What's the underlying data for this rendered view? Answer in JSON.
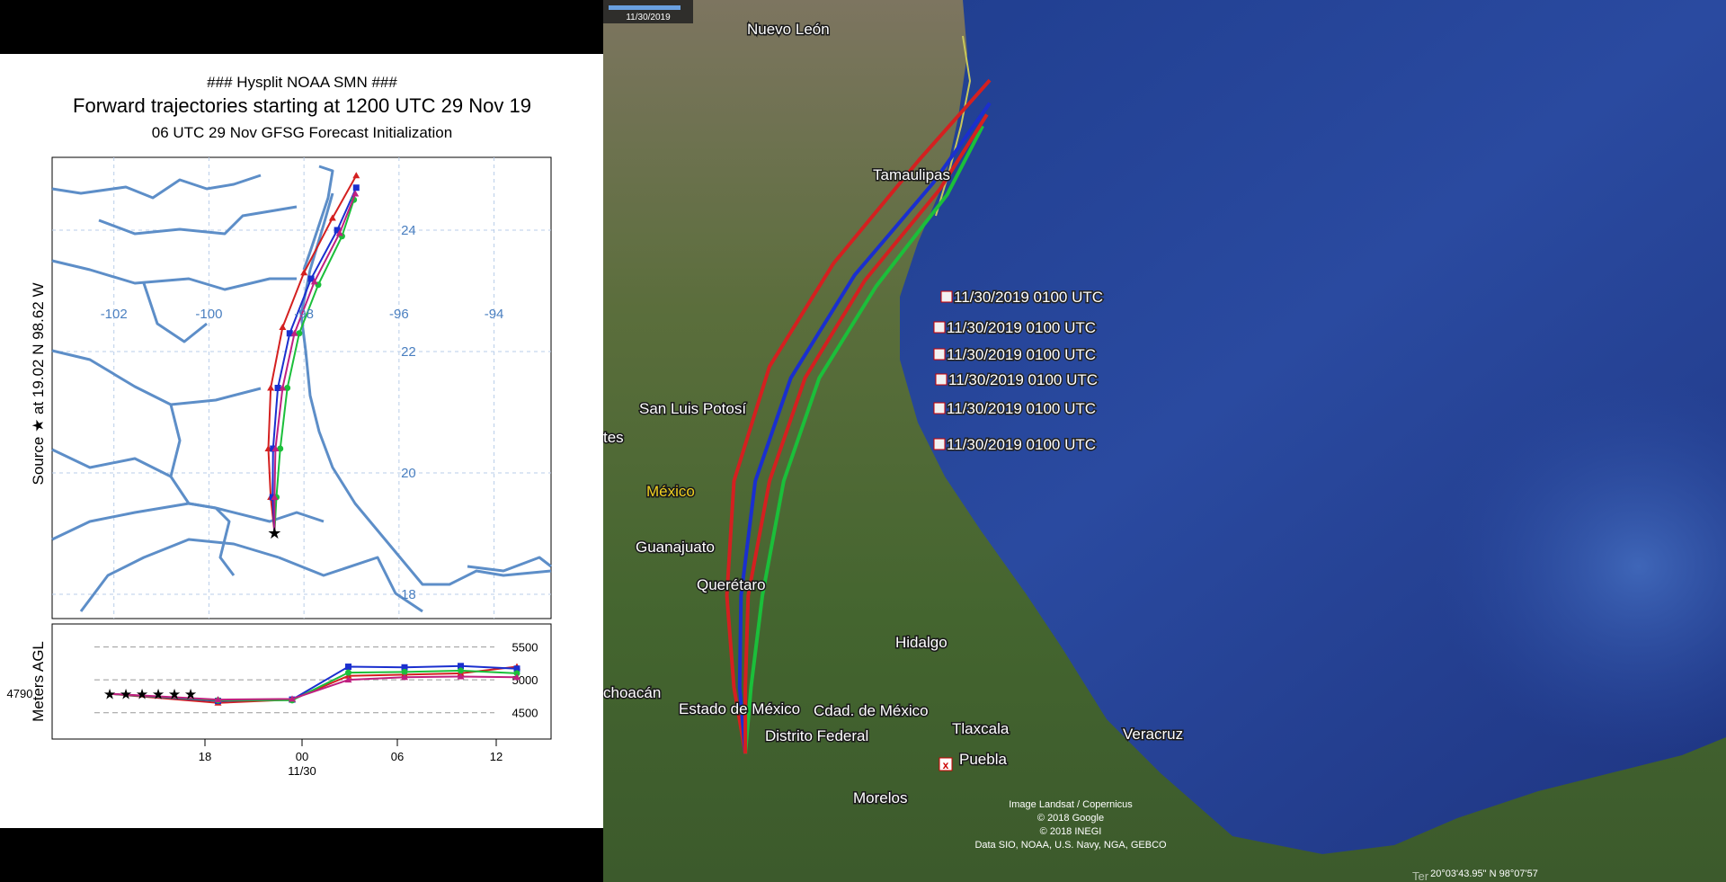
{
  "hysplit": {
    "title1": "### Hysplit NOAA  SMN ###",
    "title2": "Forward trajectories starting at 1200 UTC 29 Nov 19",
    "title3": "06 UTC 29 Nov    GFSG  Forecast Initialization",
    "source_label": "Source ★ at    19.02 N    98.62 W",
    "lon_ticks": [
      {
        "v": -102,
        "label": "-102"
      },
      {
        "v": -100,
        "label": "-100"
      },
      {
        "v": -98,
        "label": "-98"
      },
      {
        "v": -96,
        "label": "-96"
      },
      {
        "v": -94,
        "label": "-94"
      }
    ],
    "lat_ticks": [
      {
        "v": 24,
        "label": "24"
      },
      {
        "v": 22,
        "label": "22"
      },
      {
        "v": 20,
        "label": "20"
      },
      {
        "v": 18,
        "label": "18"
      }
    ],
    "height": {
      "ylabel": "Meters AGL",
      "start_label": "4790",
      "ticks": [
        "5500",
        "5000",
        "4500"
      ],
      "xticks": [
        "18",
        "00",
        "06",
        "12"
      ],
      "date_label": "11/30"
    }
  },
  "chart_data": {
    "type": "line",
    "title": "### Hysplit NOAA  SMN ###",
    "subtitle": "Forward trajectories starting at 1200 UTC 29 Nov 19",
    "source": {
      "lat": 19.02,
      "lon": -98.62
    },
    "xlim": [
      -103.3,
      -92.8
    ],
    "ylim": [
      17.6,
      25.2
    ],
    "height_ylim": [
      4100,
      5850
    ],
    "series": [
      {
        "color": "#d42020",
        "path": [
          [
            -98.62,
            19.02
          ],
          [
            -98.7,
            19.6
          ],
          [
            -98.75,
            20.4
          ],
          [
            -98.7,
            21.4
          ],
          [
            -98.45,
            22.4
          ],
          [
            -98.0,
            23.3
          ],
          [
            -97.4,
            24.2
          ],
          [
            -96.9,
            24.9
          ]
        ],
        "heights": [
          4790,
          4650,
          4700,
          5060,
          5080,
          5100,
          5200
        ]
      },
      {
        "color": "#1a2fcf",
        "path": [
          [
            -98.62,
            19.02
          ],
          [
            -98.66,
            19.6
          ],
          [
            -98.65,
            20.4
          ],
          [
            -98.55,
            21.4
          ],
          [
            -98.3,
            22.3
          ],
          [
            -97.85,
            23.2
          ],
          [
            -97.3,
            24.0
          ],
          [
            -96.9,
            24.7
          ]
        ],
        "heights": [
          4790,
          4680,
          4700,
          5200,
          5190,
          5210,
          5170
        ]
      },
      {
        "color": "#1bbf3a",
        "path": [
          [
            -98.62,
            19.02
          ],
          [
            -98.58,
            19.6
          ],
          [
            -98.5,
            20.4
          ],
          [
            -98.35,
            21.4
          ],
          [
            -98.1,
            22.3
          ],
          [
            -97.7,
            23.1
          ],
          [
            -97.2,
            23.9
          ],
          [
            -96.95,
            24.5
          ]
        ],
        "heights": [
          4790,
          4690,
          4690,
          5110,
          5120,
          5140,
          5100
        ]
      },
      {
        "color": "#c02080",
        "path": [
          [
            -98.62,
            19.02
          ],
          [
            -98.62,
            19.6
          ],
          [
            -98.6,
            20.4
          ],
          [
            -98.45,
            21.4
          ],
          [
            -98.2,
            22.3
          ],
          [
            -97.78,
            23.15
          ],
          [
            -97.25,
            23.95
          ],
          [
            -96.92,
            24.6
          ]
        ],
        "heights": [
          4790,
          4700,
          4710,
          5000,
          5040,
          5050,
          5040
        ]
      }
    ]
  },
  "google_earth": {
    "timeline_date": "11/30/2019",
    "places": [
      {
        "name": "Nuevo León"
      },
      {
        "name": "Tamaulipas"
      },
      {
        "name": "San Luis Potosí"
      },
      {
        "name": "tes"
      },
      {
        "name": "México"
      },
      {
        "name": "Guanajuato"
      },
      {
        "name": "Querétaro"
      },
      {
        "name": "Hidalgo"
      },
      {
        "name": "choacán"
      },
      {
        "name": "Estado de México"
      },
      {
        "name": "Cdad. de México"
      },
      {
        "name": "Distrito Federal"
      },
      {
        "name": "Tlaxcala"
      },
      {
        "name": "Puebla"
      },
      {
        "name": "Morelos"
      },
      {
        "name": "Veracruz"
      }
    ],
    "timestamps": [
      "11/30/2019 0100 UTC",
      "11/30/2019 0100 UTC",
      "11/30/2019 0100 UTC",
      "11/30/2019 0100 UTC",
      "11/30/2019 0100 UTC",
      "11/30/2019 0100 UTC"
    ],
    "credits": [
      "Image Landsat / Copernicus",
      "© 2018 Google",
      "© 2018 INEGI",
      "Data SIO, NOAA, U.S. Navy, NGA, GEBCO"
    ],
    "status_coords": "20°03'43.95\" N    98°07'57",
    "corner_label": "Ter"
  }
}
